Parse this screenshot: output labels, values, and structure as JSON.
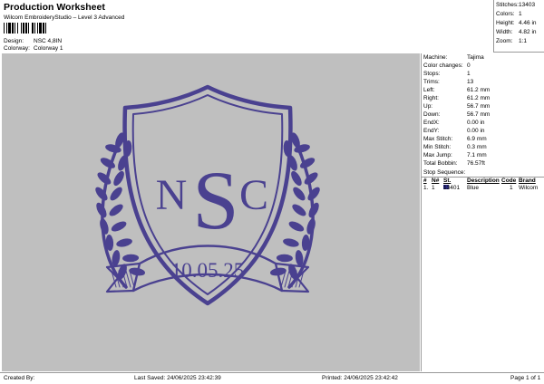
{
  "header": {
    "title": "Production Worksheet",
    "subtitle": "Wilcom EmbroideryStudio – Level 3 Advanced",
    "design_label": "Design:",
    "design_value": "NSC 4,8IN",
    "colorway_label": "Colorway:",
    "colorway_value": "Colorway 1"
  },
  "stats": {
    "stitches_label": "Stitches:",
    "stitches_value": "13403",
    "colors_label": "Colors:",
    "colors_value": "1",
    "height_label": "Height:",
    "height_value": "4.46 in",
    "width_label": "Width:",
    "width_value": "4.82 in",
    "zoom_label": "Zoom:",
    "zoom_value": "1:1"
  },
  "design": {
    "monogram_left": "N",
    "monogram_center": "S",
    "monogram_right": "C",
    "date": "10.05.25",
    "thread_color": "#4a4190",
    "canvas_color": "#bfbfbf"
  },
  "info": {
    "machine_label": "Machine:",
    "machine_value": "Tajima",
    "color_changes_label": "Color changes:",
    "color_changes_value": "0",
    "stops_label": "Stops:",
    "stops_value": "1",
    "trims_label": "Trims:",
    "trims_value": "13",
    "left_label": "Left:",
    "left_value": "61.2 mm",
    "right_label": "Right:",
    "right_value": "61.2 mm",
    "up_label": "Up:",
    "up_value": "56.7 mm",
    "down_label": "Down:",
    "down_value": "56.7 mm",
    "endx_label": "EndX:",
    "endx_value": "0.00 in",
    "endy_label": "EndY:",
    "endy_value": "0.00 in",
    "max_stitch_label": "Max Stitch:",
    "max_stitch_value": "6.9 mm",
    "min_stitch_label": "Min Stitch:",
    "min_stitch_value": "0.3 mm",
    "max_jump_label": "Max Jump:",
    "max_jump_value": "7.1 mm",
    "total_bobbin_label": "Total Bobbin:",
    "total_bobbin_value": "76.57ft"
  },
  "stop_sequence": {
    "title": "Stop Sequence:",
    "headers": [
      "#",
      "N#",
      "St.",
      "Description",
      "Code",
      "Brand"
    ],
    "rows": [
      {
        "num": "1.",
        "n": "1",
        "st": "13401",
        "color": "#2b2b80",
        "desc": "Blue",
        "code": "1",
        "brand": "Wilcom"
      }
    ]
  },
  "footer": {
    "created": "Created By:",
    "saved": "Last Saved: 24/06/2025 23:42:39",
    "printed": "Printed: 24/06/2025 23:42:42",
    "page": "Page 1 of 1"
  }
}
